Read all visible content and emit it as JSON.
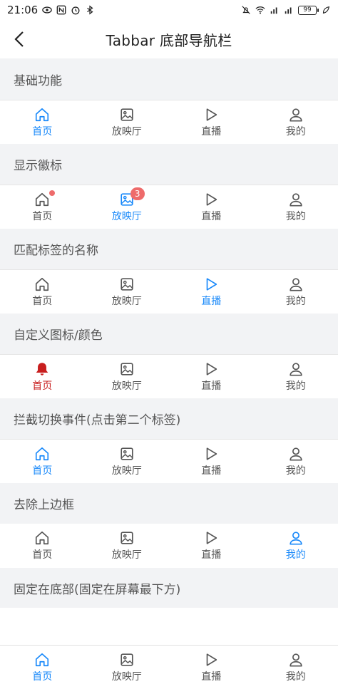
{
  "status_bar": {
    "time": "21:06",
    "battery": "99"
  },
  "nav": {
    "title": "Tabbar 底部导航栏"
  },
  "tab_labels": {
    "home": "首页",
    "cinema": "放映厅",
    "live": "直播",
    "mine": "我的"
  },
  "sections": [
    {
      "title": "基础功能"
    },
    {
      "title": "显示徽标",
      "badge": "3"
    },
    {
      "title": "匹配标签的名称"
    },
    {
      "title": "自定义图标/颜色"
    },
    {
      "title": "拦截切换事件(点击第二个标签)"
    },
    {
      "title": "去除上边框"
    },
    {
      "title": "固定在底部(固定在屏幕最下方)"
    }
  ],
  "colors": {
    "active": "#1989fa",
    "custom": "#c81e1e",
    "inactive": "#555555",
    "badge": "#ee6b6b",
    "section_bg": "#f2f3f5"
  }
}
